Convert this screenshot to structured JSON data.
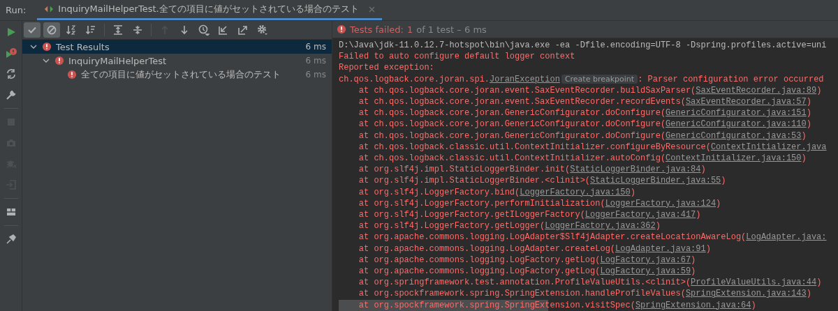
{
  "run_tabs": {
    "label": "Run:",
    "tabs": [
      {
        "title": "InquiryMailHelperTest.全ての項目に値がセットされている場合のテスト",
        "selected": true
      }
    ]
  },
  "side_actions": [
    [
      {
        "kind": "run",
        "disabled": false
      },
      {
        "kind": "rerun-failed",
        "disabled": false
      },
      {
        "kind": "auto-test",
        "disabled": false
      },
      {
        "kind": "wrench",
        "disabled": false
      }
    ],
    [
      {
        "kind": "stop",
        "disabled": true
      },
      {
        "kind": "camera",
        "disabled": true
      },
      {
        "kind": "bug",
        "disabled": true
      },
      {
        "kind": "exit",
        "disabled": true
      }
    ],
    [
      {
        "kind": "layout",
        "disabled": false
      }
    ],
    [
      {
        "kind": "pin",
        "disabled": false
      }
    ]
  ],
  "toolbar": [
    [
      {
        "kind": "check",
        "on": true,
        "disabled": false
      },
      {
        "kind": "ban",
        "on": true,
        "disabled": false
      },
      {
        "kind": "sort-alpha",
        "on": false,
        "disabled": false
      },
      {
        "kind": "sort-duration",
        "on": false,
        "disabled": false
      }
    ],
    [
      {
        "kind": "expand",
        "on": false,
        "disabled": false
      },
      {
        "kind": "collapse",
        "on": false,
        "disabled": false
      }
    ],
    [
      {
        "kind": "up",
        "on": false,
        "disabled": true
      },
      {
        "kind": "down",
        "on": false,
        "disabled": false
      },
      {
        "kind": "clock",
        "on": false,
        "disabled": false
      },
      {
        "kind": "import",
        "on": false,
        "disabled": false
      },
      {
        "kind": "export",
        "on": false,
        "disabled": false
      },
      {
        "kind": "gear",
        "on": false,
        "disabled": false
      }
    ]
  ],
  "test_tree": [
    {
      "label": "Test Results",
      "time": "6 ms",
      "failed": true,
      "selected": true,
      "expanded": true,
      "children": [
        {
          "label": "InquiryMailHelperTest",
          "time": "6 ms",
          "failed": true,
          "selected": false,
          "expanded": true,
          "children": [
            {
              "label": "全ての項目に値がセットされている場合のテスト",
              "time": "6 ms",
              "failed": true,
              "selected": false,
              "expanded": false
            }
          ]
        }
      ]
    }
  ],
  "status": {
    "failed_label": "Tests failed:",
    "failed_count": "1",
    "summary": "of 1 test – 6 ms"
  },
  "console": [
    {
      "kind": "command",
      "selected": false,
      "segments": [
        {
          "kind": "text",
          "text": "D:\\Java\\jdk-11.0.12.7-hotspot\\bin\\java.exe -ea -Dfile.encoding=UTF-8 -Dspring.profiles.active=uni"
        }
      ]
    },
    {
      "kind": "error",
      "selected": false,
      "segments": [
        {
          "kind": "text",
          "text": "Failed to auto configure default logger context"
        }
      ]
    },
    {
      "kind": "error",
      "selected": false,
      "segments": [
        {
          "kind": "text",
          "text": "Reported exception:"
        }
      ]
    },
    {
      "kind": "error",
      "selected": false,
      "segments": [
        {
          "kind": "text",
          "text": "ch.qos.logback.core.joran.spi."
        },
        {
          "kind": "link",
          "text": "JoranException"
        },
        {
          "kind": "hint",
          "text": "Create breakpoint"
        },
        {
          "kind": "text",
          "text": ": Parser configuration error occurred"
        }
      ]
    },
    {
      "kind": "error",
      "selected": false,
      "segments": [
        {
          "kind": "text",
          "text": "    at ch.qos.logback.core.joran.event.SaxEventRecorder.buildSaxParser("
        },
        {
          "kind": "link",
          "text": "SaxEventRecorder.java:89"
        },
        {
          "kind": "text",
          "text": ")"
        }
      ]
    },
    {
      "kind": "error",
      "selected": false,
      "segments": [
        {
          "kind": "text",
          "text": "    at ch.qos.logback.core.joran.event.SaxEventRecorder.recordEvents("
        },
        {
          "kind": "link",
          "text": "SaxEventRecorder.java:57"
        },
        {
          "kind": "text",
          "text": ")"
        }
      ]
    },
    {
      "kind": "error",
      "selected": false,
      "segments": [
        {
          "kind": "text",
          "text": "    at ch.qos.logback.core.joran.GenericConfigurator.doConfigure("
        },
        {
          "kind": "link",
          "text": "GenericConfigurator.java:151"
        },
        {
          "kind": "text",
          "text": ")"
        }
      ]
    },
    {
      "kind": "error",
      "selected": false,
      "segments": [
        {
          "kind": "text",
          "text": "    at ch.qos.logback.core.joran.GenericConfigurator.doConfigure("
        },
        {
          "kind": "link",
          "text": "GenericConfigurator.java:110"
        },
        {
          "kind": "text",
          "text": ")"
        }
      ]
    },
    {
      "kind": "error",
      "selected": false,
      "segments": [
        {
          "kind": "text",
          "text": "    at ch.qos.logback.core.joran.GenericConfigurator.doConfigure("
        },
        {
          "kind": "link",
          "text": "GenericConfigurator.java:53"
        },
        {
          "kind": "text",
          "text": ")"
        }
      ]
    },
    {
      "kind": "error",
      "selected": false,
      "segments": [
        {
          "kind": "text",
          "text": "    at ch.qos.logback.classic.util.ContextInitializer.configureByResource("
        },
        {
          "kind": "link",
          "text": "ContextInitializer.java"
        }
      ]
    },
    {
      "kind": "error",
      "selected": false,
      "segments": [
        {
          "kind": "text",
          "text": "    at ch.qos.logback.classic.util.ContextInitializer.autoConfig("
        },
        {
          "kind": "link",
          "text": "ContextInitializer.java:150"
        },
        {
          "kind": "text",
          "text": ")"
        }
      ]
    },
    {
      "kind": "error",
      "selected": false,
      "segments": [
        {
          "kind": "text",
          "text": "    at org.slf4j.impl.StaticLoggerBinder.init("
        },
        {
          "kind": "link",
          "text": "StaticLoggerBinder.java:84"
        },
        {
          "kind": "text",
          "text": ")"
        }
      ]
    },
    {
      "kind": "error",
      "selected": false,
      "segments": [
        {
          "kind": "text",
          "text": "    at org.slf4j.impl.StaticLoggerBinder.<clinit>("
        },
        {
          "kind": "link",
          "text": "StaticLoggerBinder.java:55"
        },
        {
          "kind": "text",
          "text": ")"
        }
      ]
    },
    {
      "kind": "error",
      "selected": false,
      "segments": [
        {
          "kind": "text",
          "text": "    at org.slf4j.LoggerFactory.bind("
        },
        {
          "kind": "link",
          "text": "LoggerFactory.java:150"
        },
        {
          "kind": "text",
          "text": ")"
        }
      ]
    },
    {
      "kind": "error",
      "selected": false,
      "segments": [
        {
          "kind": "text",
          "text": "    at org.slf4j.LoggerFactory.performInitialization("
        },
        {
          "kind": "link",
          "text": "LoggerFactory.java:124"
        },
        {
          "kind": "text",
          "text": ")"
        }
      ]
    },
    {
      "kind": "error",
      "selected": false,
      "segments": [
        {
          "kind": "text",
          "text": "    at org.slf4j.LoggerFactory.getILoggerFactory("
        },
        {
          "kind": "link",
          "text": "LoggerFactory.java:417"
        },
        {
          "kind": "text",
          "text": ")"
        }
      ]
    },
    {
      "kind": "error",
      "selected": false,
      "segments": [
        {
          "kind": "text",
          "text": "    at org.slf4j.LoggerFactory.getLogger("
        },
        {
          "kind": "link",
          "text": "LoggerFactory.java:362"
        },
        {
          "kind": "text",
          "text": ")"
        }
      ]
    },
    {
      "kind": "error",
      "selected": false,
      "segments": [
        {
          "kind": "text",
          "text": "    at org.apache.commons.logging.LogAdapter$Slf4jAdapter.createLocationAwareLog("
        },
        {
          "kind": "link",
          "text": "LogAdapter.java:"
        }
      ]
    },
    {
      "kind": "error",
      "selected": false,
      "segments": [
        {
          "kind": "text",
          "text": "    at org.apache.commons.logging.LogAdapter.createLog("
        },
        {
          "kind": "link",
          "text": "LogAdapter.java:91"
        },
        {
          "kind": "text",
          "text": ")"
        }
      ]
    },
    {
      "kind": "error",
      "selected": false,
      "segments": [
        {
          "kind": "text",
          "text": "    at org.apache.commons.logging.LogFactory.getLog("
        },
        {
          "kind": "link",
          "text": "LogFactory.java:67"
        },
        {
          "kind": "text",
          "text": ")"
        }
      ]
    },
    {
      "kind": "error",
      "selected": false,
      "segments": [
        {
          "kind": "text",
          "text": "    at org.apache.commons.logging.LogFactory.getLog("
        },
        {
          "kind": "link",
          "text": "LogFactory.java:59"
        },
        {
          "kind": "text",
          "text": ")"
        }
      ]
    },
    {
      "kind": "error",
      "selected": false,
      "segments": [
        {
          "kind": "text",
          "text": "    at org.springframework.test.annotation.ProfileValueUtils.<clinit>("
        },
        {
          "kind": "link",
          "text": "ProfileValueUtils.java:44"
        },
        {
          "kind": "text",
          "text": ")"
        }
      ]
    },
    {
      "kind": "error",
      "selected": false,
      "segments": [
        {
          "kind": "text",
          "text": "    at org.spockframework.spring.SpringExtension.handleProfileValues("
        },
        {
          "kind": "link",
          "text": "SpringExtension.java:143"
        },
        {
          "kind": "text",
          "text": ")"
        }
      ]
    },
    {
      "kind": "error",
      "selected": true,
      "segments": [
        {
          "kind": "text",
          "text": "    at org.spockframework.spring.SpringExtension.visitSpec("
        },
        {
          "kind": "link",
          "text": "SpringExtension.java:64"
        },
        {
          "kind": "text",
          "text": ")"
        }
      ]
    }
  ]
}
